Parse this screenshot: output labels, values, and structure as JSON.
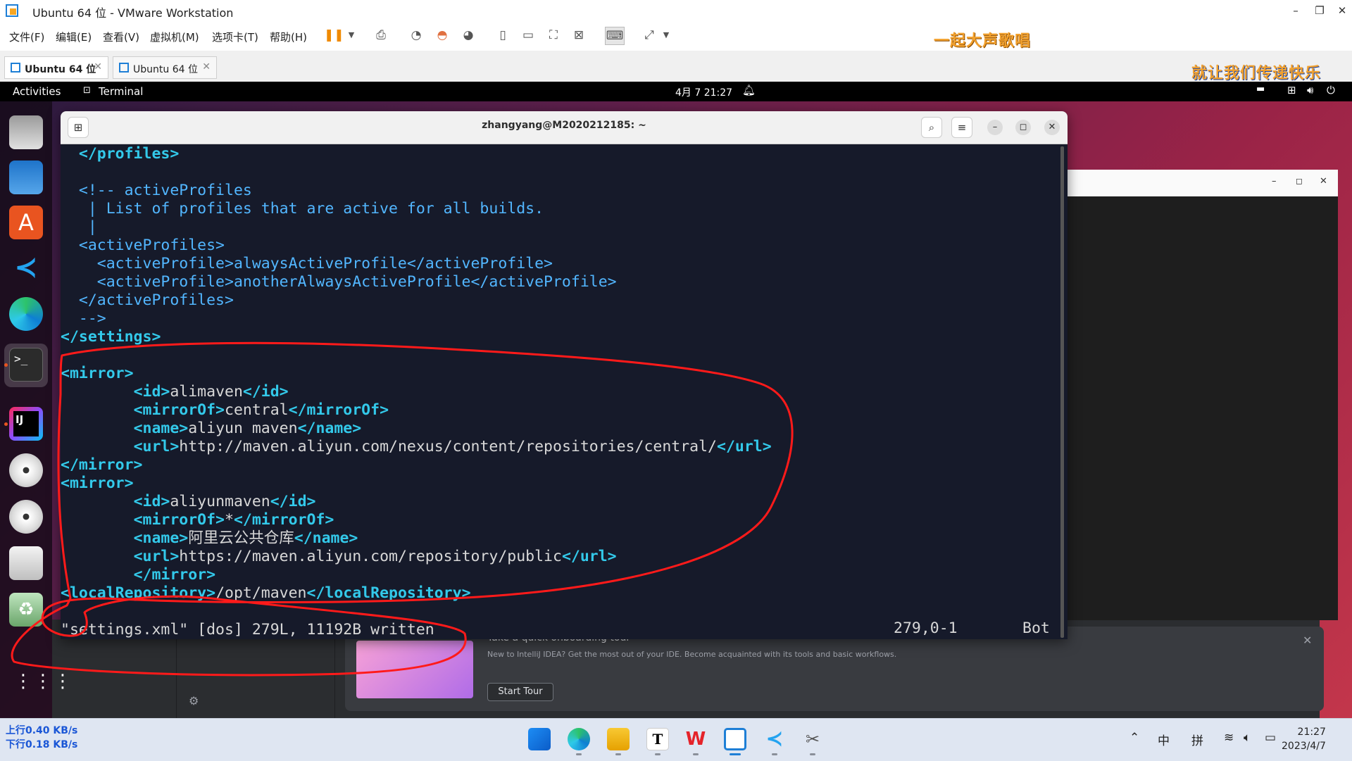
{
  "vmware": {
    "title": "Ubuntu 64 位 - VMware Workstation",
    "menu": [
      "文件(F)",
      "编辑(E)",
      "查看(V)",
      "虚拟机(M)",
      "选项卡(T)",
      "帮助(H)"
    ],
    "slogan_top": "一起大声歌唱",
    "slogan_bottom": "就让我们传递快乐",
    "tabs": [
      {
        "label": "Ubuntu 64 位",
        "active": true
      },
      {
        "label": "Ubuntu 64 位",
        "active": false
      }
    ]
  },
  "ubuntu_topbar": {
    "activities": "Activities",
    "app": "Terminal",
    "datetime": "4月 7  21:27"
  },
  "terminal": {
    "title": "zhangyang@M2020212185: ~",
    "lines": [
      [
        [
          "c-tag",
          "  </profiles>"
        ]
      ],
      [
        [
          "c-text",
          ""
        ]
      ],
      [
        [
          "c-comment",
          "  <!-- activeProfiles"
        ]
      ],
      [
        [
          "c-comment",
          "   | List of profiles that are active for all builds."
        ]
      ],
      [
        [
          "c-comment",
          "   |"
        ]
      ],
      [
        [
          "c-comment",
          "  <activeProfiles>"
        ]
      ],
      [
        [
          "c-comment",
          "    <activeProfile>alwaysActiveProfile</activeProfile>"
        ]
      ],
      [
        [
          "c-comment",
          "    <activeProfile>anotherAlwaysActiveProfile</activeProfile>"
        ]
      ],
      [
        [
          "c-comment",
          "  </activeProfiles>"
        ]
      ],
      [
        [
          "c-comment",
          "  -->"
        ]
      ],
      [
        [
          "c-tag",
          "</settings>"
        ]
      ],
      [
        [
          "c-text",
          ""
        ]
      ],
      [
        [
          "c-tag",
          "<mirror>"
        ]
      ],
      [
        [
          "c-text",
          "        "
        ],
        [
          "c-tag",
          "<id>"
        ],
        [
          "c-text",
          "alimaven"
        ],
        [
          "c-tag",
          "</id>"
        ]
      ],
      [
        [
          "c-text",
          "        "
        ],
        [
          "c-tag",
          "<mirrorOf>"
        ],
        [
          "c-text",
          "central"
        ],
        [
          "c-tag",
          "</mirrorOf>"
        ]
      ],
      [
        [
          "c-text",
          "        "
        ],
        [
          "c-tag",
          "<name>"
        ],
        [
          "c-text",
          "aliyun maven"
        ],
        [
          "c-tag",
          "</name>"
        ]
      ],
      [
        [
          "c-text",
          "        "
        ],
        [
          "c-tag",
          "<url>"
        ],
        [
          "c-text",
          "http://maven.aliyun.com/nexus/content/repositories/central/"
        ],
        [
          "c-tag",
          "</url>"
        ]
      ],
      [
        [
          "c-tag",
          "</mirror>"
        ]
      ],
      [
        [
          "c-tag",
          "<mirror>"
        ]
      ],
      [
        [
          "c-text",
          "        "
        ],
        [
          "c-tag",
          "<id>"
        ],
        [
          "c-text",
          "aliyunmaven"
        ],
        [
          "c-tag",
          "</id>"
        ]
      ],
      [
        [
          "c-text",
          "        "
        ],
        [
          "c-tag",
          "<mirrorOf>"
        ],
        [
          "c-text",
          "*"
        ],
        [
          "c-tag",
          "</mirrorOf>"
        ]
      ],
      [
        [
          "c-text",
          "        "
        ],
        [
          "c-tag",
          "<name>"
        ],
        [
          "c-text",
          "阿里云公共仓库"
        ],
        [
          "c-tag",
          "</name>"
        ]
      ],
      [
        [
          "c-text",
          "        "
        ],
        [
          "c-tag",
          "<url>"
        ],
        [
          "c-text",
          "https://maven.aliyun.com/repository/public"
        ],
        [
          "c-tag",
          "</url>"
        ]
      ],
      [
        [
          "c-text",
          "        "
        ],
        [
          "c-tag",
          "</mirror>"
        ]
      ],
      [
        [
          "c-tag",
          "<localRepository>"
        ],
        [
          "c-text",
          "/opt/maven"
        ],
        [
          "c-tag",
          "</localRepository>"
        ]
      ],
      [
        [
          "c-text",
          ""
        ]
      ],
      [
        [
          "c-gray",
          "\"settings.xml\" [dos] 279L, 11192B written"
        ]
      ]
    ],
    "status_pos": "279,0-1",
    "status_where": "Bot"
  },
  "intellij": {
    "tour_title": "Take a quick onboarding tour",
    "tour_desc": "New to IntelliJ IDEA? Get the most out of your IDE. Become acquainted with its tools and basic workflows.",
    "tour_button": "Start Tour"
  },
  "taskbar": {
    "up_speed": "上行0.40 KB/s",
    "down_speed": "下行0.18 KB/s",
    "ime_mode": "中",
    "ime_type": "拼",
    "time": "21:27",
    "date": "2023/4/7"
  },
  "colors": {
    "accent_red": "#ff1a1a",
    "ubuntu_orange": "#e95420"
  }
}
